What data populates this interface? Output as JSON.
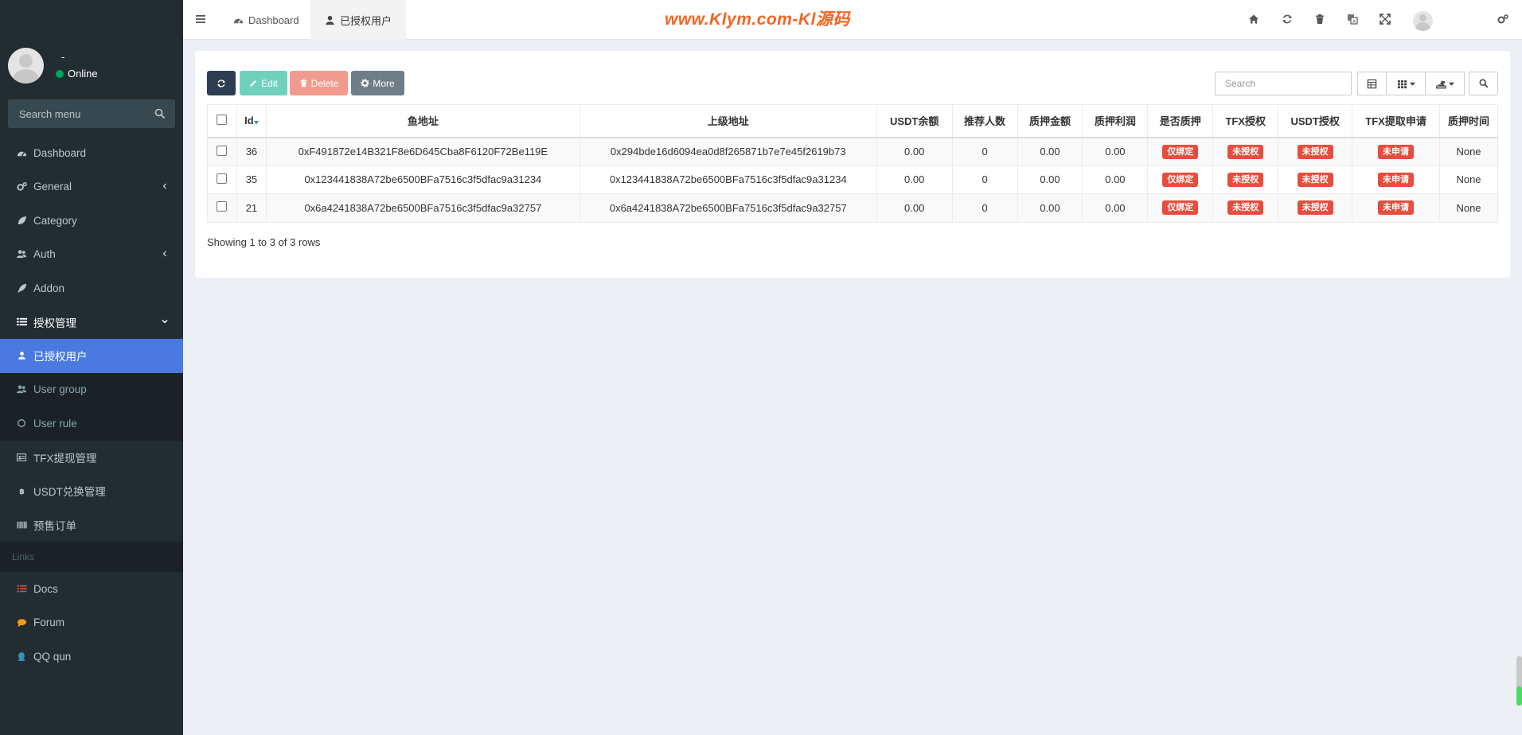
{
  "sidebar": {
    "user_name": "-",
    "user_status": "Online",
    "search_placeholder": "Search menu",
    "items": [
      {
        "label": "Dashboard"
      },
      {
        "label": "General"
      },
      {
        "label": "Category"
      },
      {
        "label": "Auth"
      },
      {
        "label": "Addon"
      },
      {
        "label": "授权管理"
      },
      {
        "label": "已授权用户"
      },
      {
        "label": "User group"
      },
      {
        "label": "User rule"
      },
      {
        "label": "TFX提现管理"
      },
      {
        "label": "USDT兑换管理"
      },
      {
        "label": "预售订单"
      }
    ],
    "links_header": "Links",
    "links": [
      {
        "label": "Docs"
      },
      {
        "label": "Forum"
      },
      {
        "label": "QQ qun"
      }
    ]
  },
  "topbar": {
    "tabs": [
      {
        "label": "Dashboard"
      },
      {
        "label": "已授权用户"
      }
    ],
    "watermark": "www.Klym.com-Kl源码"
  },
  "toolbar": {
    "edit_label": "Edit",
    "delete_label": "Delete",
    "more_label": "More",
    "search_placeholder": "Search"
  },
  "table": {
    "columns": [
      "Id",
      "鱼地址",
      "上级地址",
      "USDT余额",
      "推荐人数",
      "质押金额",
      "质押利润",
      "是否质押",
      "TFX授权",
      "USDT授权",
      "TFX提取申请",
      "质押时间"
    ],
    "rows": [
      {
        "id": "36",
        "fish": "0xF491872e14B321F8e6D645Cba8F6120F72Be119E",
        "parent": "0x294bde16d6094ea0d8f265871b7e7e45f2619b73",
        "usdt": "0.00",
        "refs": "0",
        "stake": "0.00",
        "profit": "0.00",
        "staked": "仅绑定",
        "tfx_auth": "未授权",
        "usdt_auth": "未授权",
        "tfx_apply": "未申请",
        "stake_time": "None"
      },
      {
        "id": "35",
        "fish": "0x123441838A72be6500BFa7516c3f5dfac9a31234",
        "parent": "0x123441838A72be6500BFa7516c3f5dfac9a31234",
        "usdt": "0.00",
        "refs": "0",
        "stake": "0.00",
        "profit": "0.00",
        "staked": "仅绑定",
        "tfx_auth": "未授权",
        "usdt_auth": "未授权",
        "tfx_apply": "未申请",
        "stake_time": "None"
      },
      {
        "id": "21",
        "fish": "0x6a4241838A72be6500BFa7516c3f5dfac9a32757",
        "parent": "0x6a4241838A72be6500BFa7516c3f5dfac9a32757",
        "usdt": "0.00",
        "refs": "0",
        "stake": "0.00",
        "profit": "0.00",
        "staked": "仅绑定",
        "tfx_auth": "未授权",
        "usdt_auth": "未授权",
        "tfx_apply": "未申请",
        "stake_time": "None"
      }
    ],
    "footer": "Showing 1 to 3 of 3 rows"
  },
  "colors": {
    "sidebar_bg": "#222d32",
    "active_item": "#4a7ae0",
    "label_red": "#e74c3c",
    "watermark": "#f26522"
  }
}
